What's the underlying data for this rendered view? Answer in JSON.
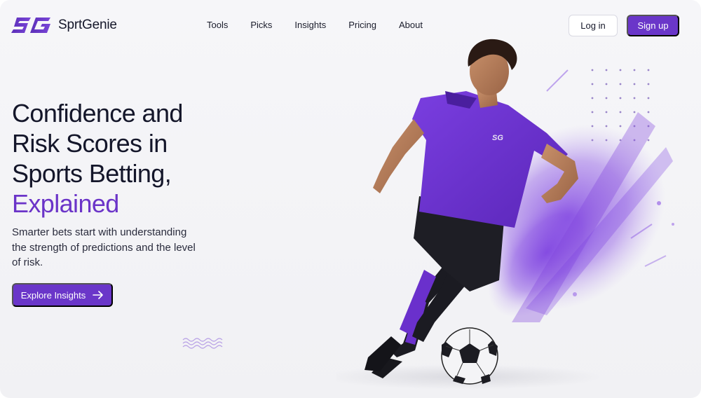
{
  "header": {
    "brand": "SprtGenie",
    "nav": [
      "Tools",
      "Picks",
      "Insights",
      "Pricing",
      "About"
    ],
    "login_label": "Log in",
    "signup_label": "Sign up"
  },
  "hero": {
    "title_lines": [
      "Confidence and",
      "Risk Scores in",
      "Sports Betting,"
    ],
    "title_accent": "Explained",
    "subtitle": "Smarter bets start with understanding the strength of predictions and the level of risk.",
    "cta_label": "Explore Insights"
  },
  "player": {
    "jersey_logo": "SG"
  },
  "colors": {
    "accent": "#6a36c9",
    "text": "#14162a",
    "background": "#f5f5f8"
  },
  "icons": [
    "sg-logo-icon",
    "arrow-right-icon",
    "wave-decoration-icon"
  ]
}
